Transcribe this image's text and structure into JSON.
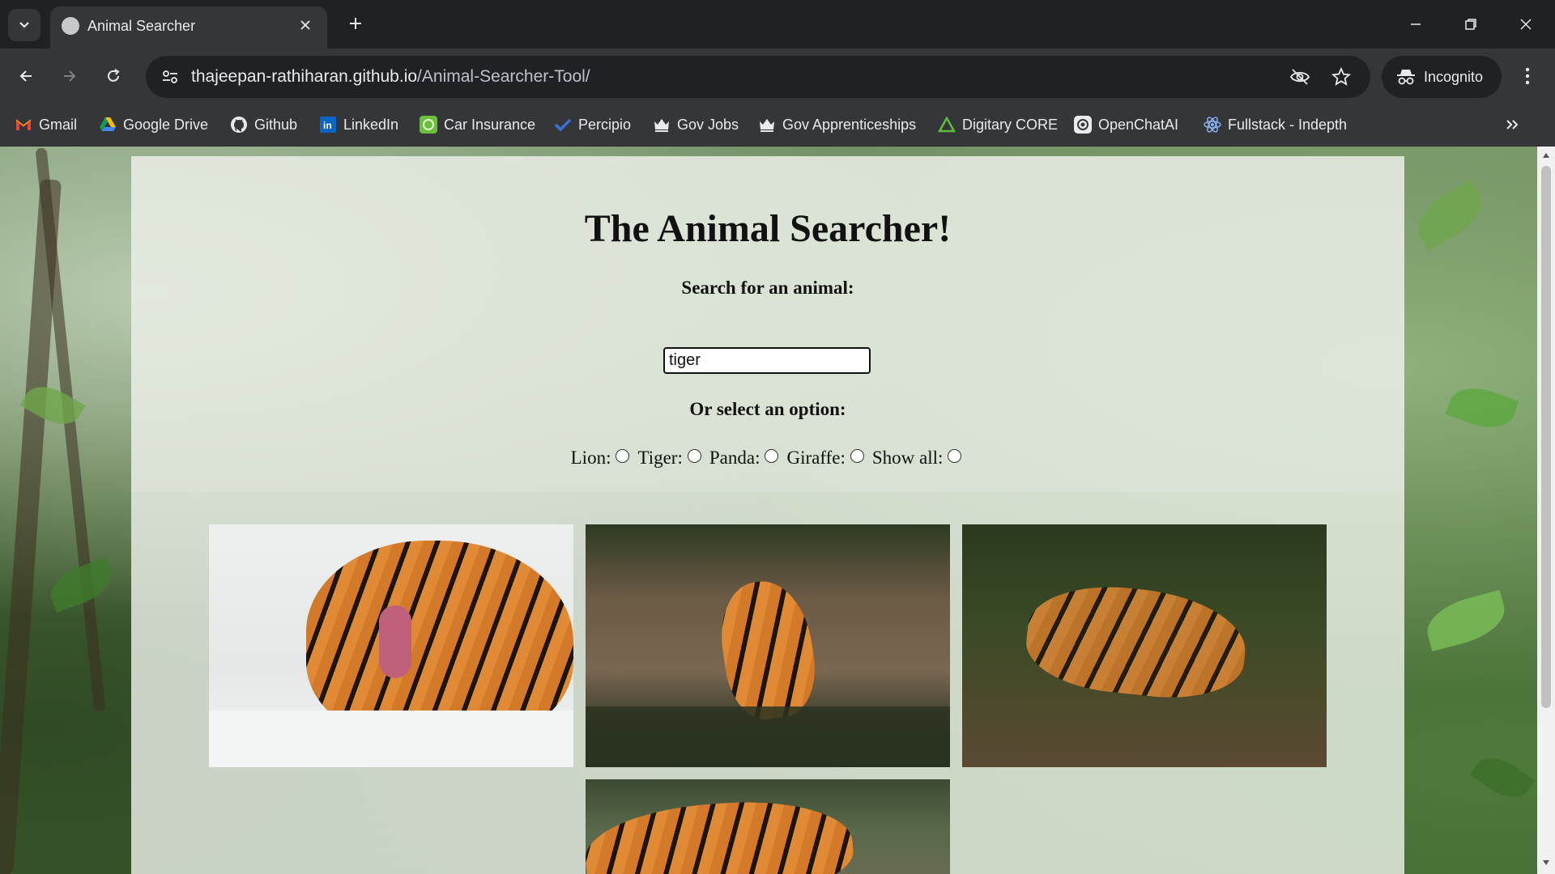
{
  "browser": {
    "tab": {
      "title": "Animal Searcher"
    },
    "url": {
      "host": "thajeepan-rathiharan.github.io",
      "path": "/Animal-Searcher-Tool/"
    },
    "profile_label": "Incognito",
    "bookmarks": [
      {
        "label": "Gmail",
        "icon": "gmail-icon"
      },
      {
        "label": "Google Drive",
        "icon": "google-drive-icon"
      },
      {
        "label": "Github",
        "icon": "github-icon"
      },
      {
        "label": "LinkedIn",
        "icon": "linkedin-icon"
      },
      {
        "label": "Car Insurance",
        "icon": "car-insurance-icon"
      },
      {
        "label": "Percipio",
        "icon": "percipio-icon"
      },
      {
        "label": "Gov Jobs",
        "icon": "crown-icon"
      },
      {
        "label": "Gov Apprenticeships",
        "icon": "crown-icon"
      },
      {
        "label": "Digitary CORE",
        "icon": "triangle-icon"
      },
      {
        "label": "OpenChatAI",
        "icon": "openai-icon"
      },
      {
        "label": "Fullstack - Indepth",
        "icon": "react-icon"
      }
    ]
  },
  "page": {
    "title": "The Animal Searcher!",
    "search_label": "Search for an animal:",
    "search_value": "tiger",
    "option_label": "Or select an option:",
    "options": [
      {
        "label": "Lion:"
      },
      {
        "label": "Tiger:"
      },
      {
        "label": "Panda:"
      },
      {
        "label": "Giraffe:"
      },
      {
        "label": "Show all:"
      }
    ]
  }
}
